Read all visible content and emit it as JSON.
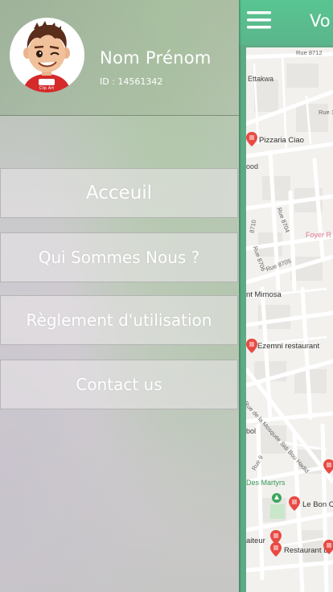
{
  "drawer": {
    "user_name": "Nom Prénom",
    "user_id": "ID : 14561342",
    "avatar_caption": "Clip Art",
    "menu": [
      {
        "label": "Acceuil"
      },
      {
        "label": "Qui Sommes Nous ?"
      },
      {
        "label": "Règlement d'utilisation"
      },
      {
        "label": "Contact us"
      }
    ]
  },
  "appbar": {
    "title": "Vo",
    "menu_icon": "hamburger-menu-icon",
    "color": "#5bc18f"
  },
  "map": {
    "labels": {
      "rue_8712": "Rue 8712",
      "ettakwa": "Ettakwa",
      "rue_top": "Rue 1",
      "pizzaria": "Pizzaria Ciao",
      "food": "ood",
      "rue_8710": "8710",
      "rue_8704": "Rue 8704",
      "rue_8706": "Rue 8706",
      "rue_8705": "Rue 8705",
      "foyer": "Foyer R",
      "mimosa": "nt Mimosa",
      "ezemni": "Ezemni restaurant",
      "mosquee": "Rue de la Mosquée Sidi Bou Hadid",
      "bol": "bol",
      "rue_9": "Rue 9",
      "martyrs": "Des Martyrs",
      "le_bon": "Le Bon C",
      "traiteur": "aiteur",
      "restaurant_l": "Restaurant L"
    }
  }
}
